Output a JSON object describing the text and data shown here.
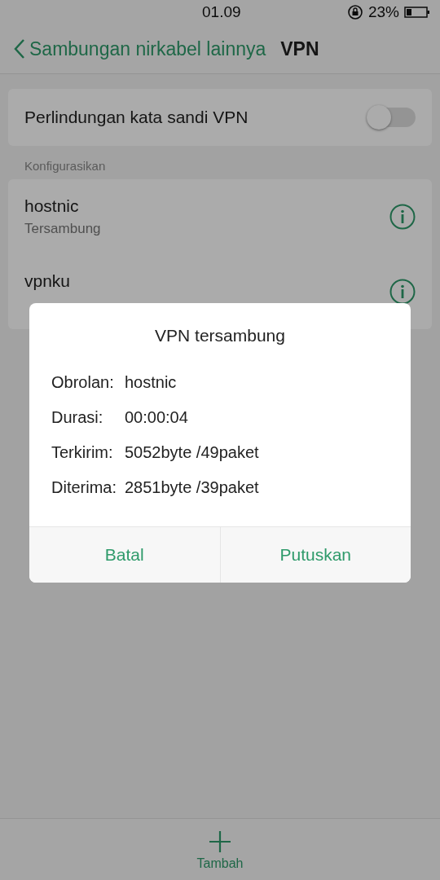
{
  "status_bar": {
    "time": "01.09",
    "battery": "23%"
  },
  "header": {
    "back_label": "Sambungan nirkabel lainnya",
    "title": "VPN"
  },
  "password_protection": {
    "label": "Perlindungan kata sandi VPN",
    "on": false
  },
  "section_label": "Konfigurasikan",
  "vpn_list": [
    {
      "name": "hostnic",
      "status": "Tersambung"
    },
    {
      "name": "vpnku"
    }
  ],
  "dialog": {
    "title": "VPN tersambung",
    "rows": [
      {
        "label": "Obrolan:",
        "value": "hostnic"
      },
      {
        "label": "Durasi:",
        "value": "00:00:04"
      },
      {
        "label": "Terkirim:",
        "value": "5052byte /49paket"
      },
      {
        "label": "Diterima:",
        "value": "2851byte /39paket"
      }
    ],
    "buttons": [
      "Batal",
      "Putuskan"
    ]
  },
  "bottom_bar": {
    "add_label": "Tambah"
  }
}
